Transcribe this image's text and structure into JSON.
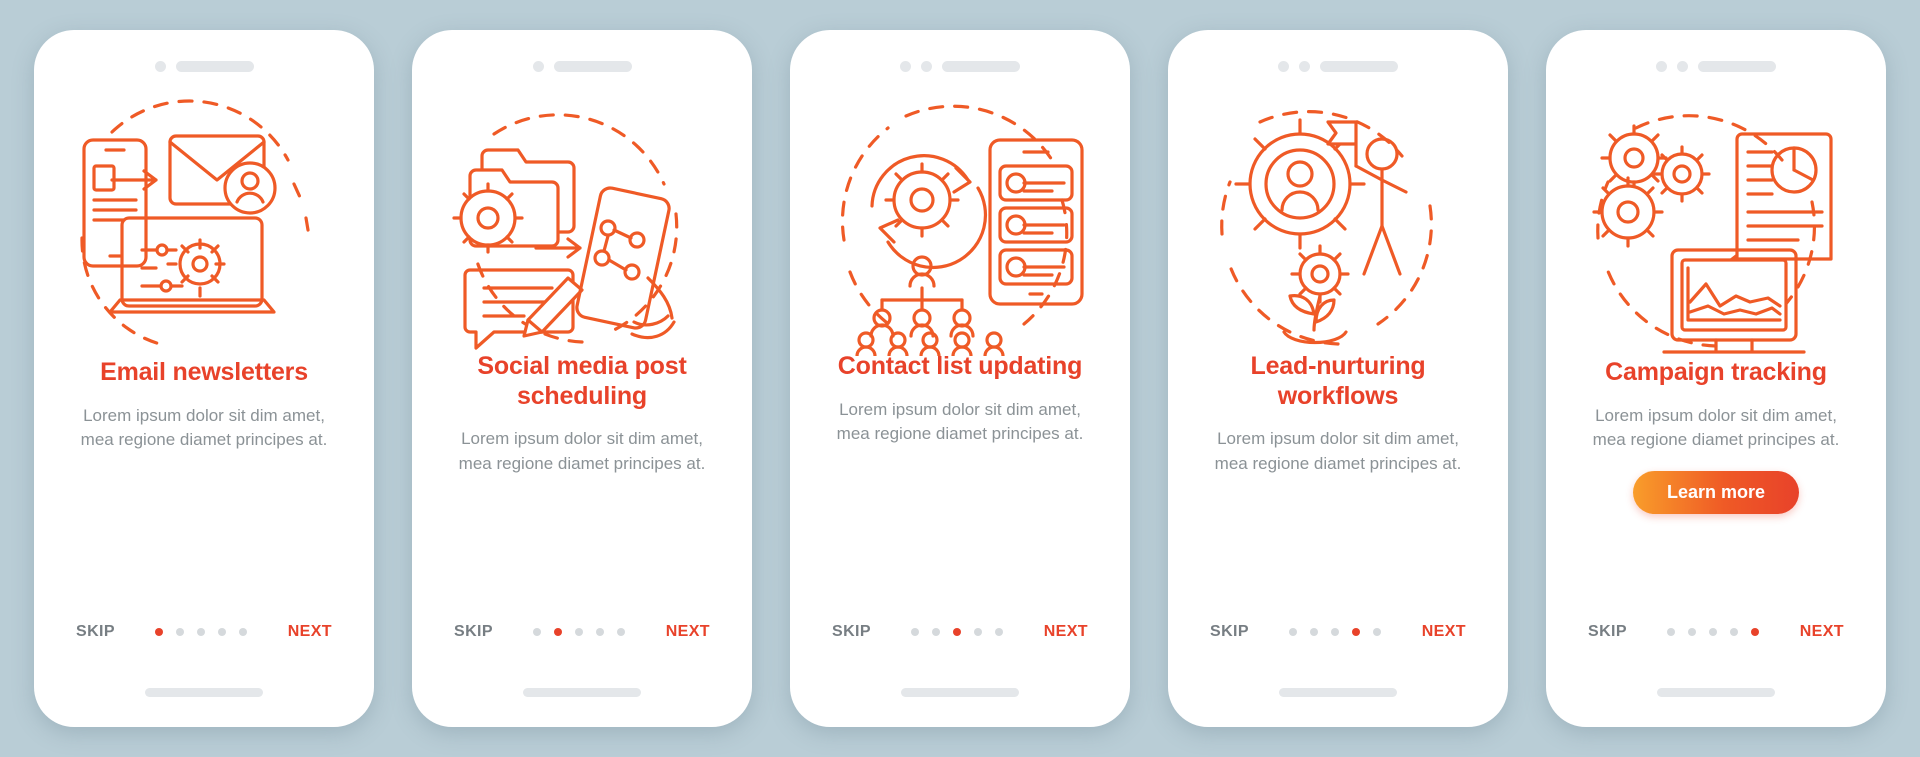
{
  "background_color": "#b9cdd6",
  "accent_color": "#e8422a",
  "muted_text_color": "#8b9296",
  "screens": [
    {
      "id": "email-newsletters",
      "icon": "phone-envelope-laptop-icon",
      "title": "Email newsletters",
      "body": "Lorem ipsum dolor sit dim amet, mea regione diamet principes at.",
      "skip_label": "SKIP",
      "next_label": "NEXT",
      "cta_label": null,
      "dots": 5,
      "active_dot": 1,
      "dock_dots": 1
    },
    {
      "id": "social-media-post-scheduling",
      "icon": "folder-gear-pencil-phone-icon",
      "title": "Social media post scheduling",
      "body": "Lorem ipsum dolor sit dim amet, mea regione diamet principes at.",
      "skip_label": "SKIP",
      "next_label": "NEXT",
      "cta_label": null,
      "dots": 5,
      "active_dot": 2,
      "dock_dots": 1
    },
    {
      "id": "contact-list-updating",
      "icon": "gear-refresh-contacts-hierarchy-icon",
      "title": "Contact list updating",
      "body": "Lorem ipsum dolor sit dim amet, mea regione diamet principes at.",
      "skip_label": "SKIP",
      "next_label": "NEXT",
      "cta_label": null,
      "dots": 5,
      "active_dot": 3,
      "dock_dots": 2
    },
    {
      "id": "lead-nurturing-workflows",
      "icon": "gear-person-plant-flag-icon",
      "title": "Lead-nurturing workflows",
      "body": "Lorem ipsum dolor sit dim amet, mea regione diamet principes at.",
      "skip_label": "SKIP",
      "next_label": "NEXT",
      "cta_label": null,
      "dots": 5,
      "active_dot": 4,
      "dock_dots": 2
    },
    {
      "id": "campaign-tracking",
      "icon": "gears-report-chart-monitor-icon",
      "title": "Campaign tracking",
      "body": "Lorem ipsum dolor sit dim amet, mea regione diamet principes at.",
      "skip_label": "SKIP",
      "next_label": "NEXT",
      "cta_label": "Learn more",
      "dots": 5,
      "active_dot": 5,
      "dock_dots": 2
    }
  ]
}
